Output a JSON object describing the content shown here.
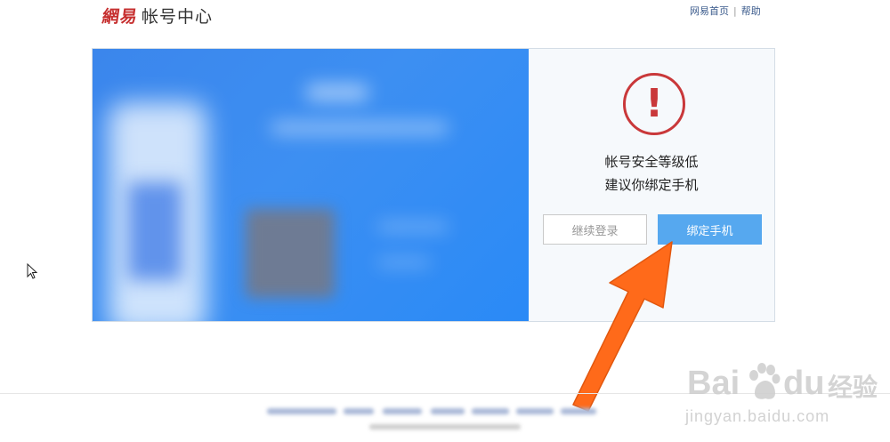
{
  "header": {
    "brand": "網易",
    "title": "帐号中心",
    "links": {
      "home": "网易首页",
      "separator": "|",
      "help": "帮助"
    }
  },
  "security_panel": {
    "icon": "exclamation-circle-icon",
    "message_line1": "帐号安全等级低",
    "message_line2": "建议你绑定手机",
    "continue_button": "继续登录",
    "bind_button": "绑定手机"
  },
  "colors": {
    "brand_red": "#c62f2f",
    "warning_red": "#c9383a",
    "primary_blue": "#56a8ef",
    "banner_blue": "#3d8ff2",
    "annotation_orange": "#ff6a1a"
  },
  "watermark": {
    "brand_left": "Bai",
    "brand_right": "du",
    "brand_cn": "经验",
    "url": "jingyan.baidu.com"
  }
}
